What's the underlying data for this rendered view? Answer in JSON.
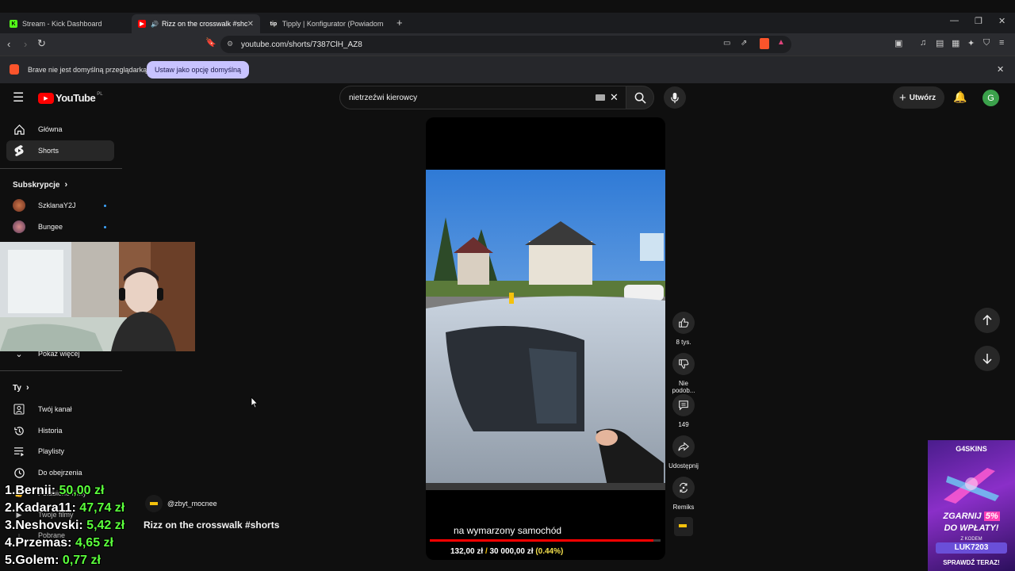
{
  "browser": {
    "tabs": [
      {
        "title": "Stream - Kick Dashboard"
      },
      {
        "title": "Rizz on the crosswalk #shorts"
      },
      {
        "title": "Tipply | Konfigurator (Powiadomienia)"
      }
    ],
    "url": "youtube.com/shorts/7387ClH_AZ8",
    "infobar": {
      "message": "Brave nie jest domyślną przeglądarką",
      "button": "Ustaw jako opcję domyślną"
    }
  },
  "youtube": {
    "logo_text": "YouTube",
    "region": "PL",
    "search": {
      "query": "nietrzeźwi kierowcy"
    },
    "create_label": "Utwórz",
    "avatar_letter": "G"
  },
  "sidebar": {
    "items": [
      {
        "label": "Główna"
      },
      {
        "label": "Shorts"
      }
    ],
    "subscriptions_header": "Subskrypcje",
    "subscriptions": [
      {
        "label": "SzklanaY2J"
      },
      {
        "label": "Bungee"
      }
    ],
    "show_more": "Pokaż więcej",
    "you_header": "Ty",
    "you_items": [
      {
        "label": "Twój kanał"
      },
      {
        "label": "Historia"
      },
      {
        "label": "Playlisty"
      },
      {
        "label": "Do obejrzenia"
      },
      {
        "label": "Polubione filmy"
      },
      {
        "label": "Twoje filmy"
      },
      {
        "label": "Pobrane"
      }
    ]
  },
  "short": {
    "channel": "@zbyt_mocnee",
    "title": "Rizz on the crosswalk #shorts",
    "caption": "na wymarzony samochód",
    "progress": 0.97,
    "actions": {
      "like_count": "8 tys.",
      "dislike_label": "Nie podob...",
      "comments_count": "149",
      "share_label": "Udostępnij",
      "remix_label": "Remiks"
    }
  },
  "overlay": {
    "donations": [
      {
        "rank": "1.",
        "name": "Bernii:",
        "amount": "50,00 zł"
      },
      {
        "rank": "2.",
        "name": "Kadara11:",
        "amount": "47,74 zł"
      },
      {
        "rank": "3.",
        "name": "Neshovski:",
        "amount": "5,42 zł"
      },
      {
        "rank": "4.",
        "name": "Przemas:",
        "amount": "4,65 zł"
      },
      {
        "rank": "5.",
        "name": "Golem:",
        "amount": "0,77 zł"
      }
    ],
    "goal": {
      "current": "132,00 zł",
      "target": "30 000,00 zł",
      "percent": "(0.44%)"
    },
    "ad": {
      "brand": "G4SKINS",
      "line1": "ZGARNIJ",
      "bonus": "5%",
      "line2": "DO WPŁATY!",
      "code_label": "Z KODEM",
      "code": "LUK7203",
      "cta": "SPRAWDŹ TERAZ!"
    }
  }
}
